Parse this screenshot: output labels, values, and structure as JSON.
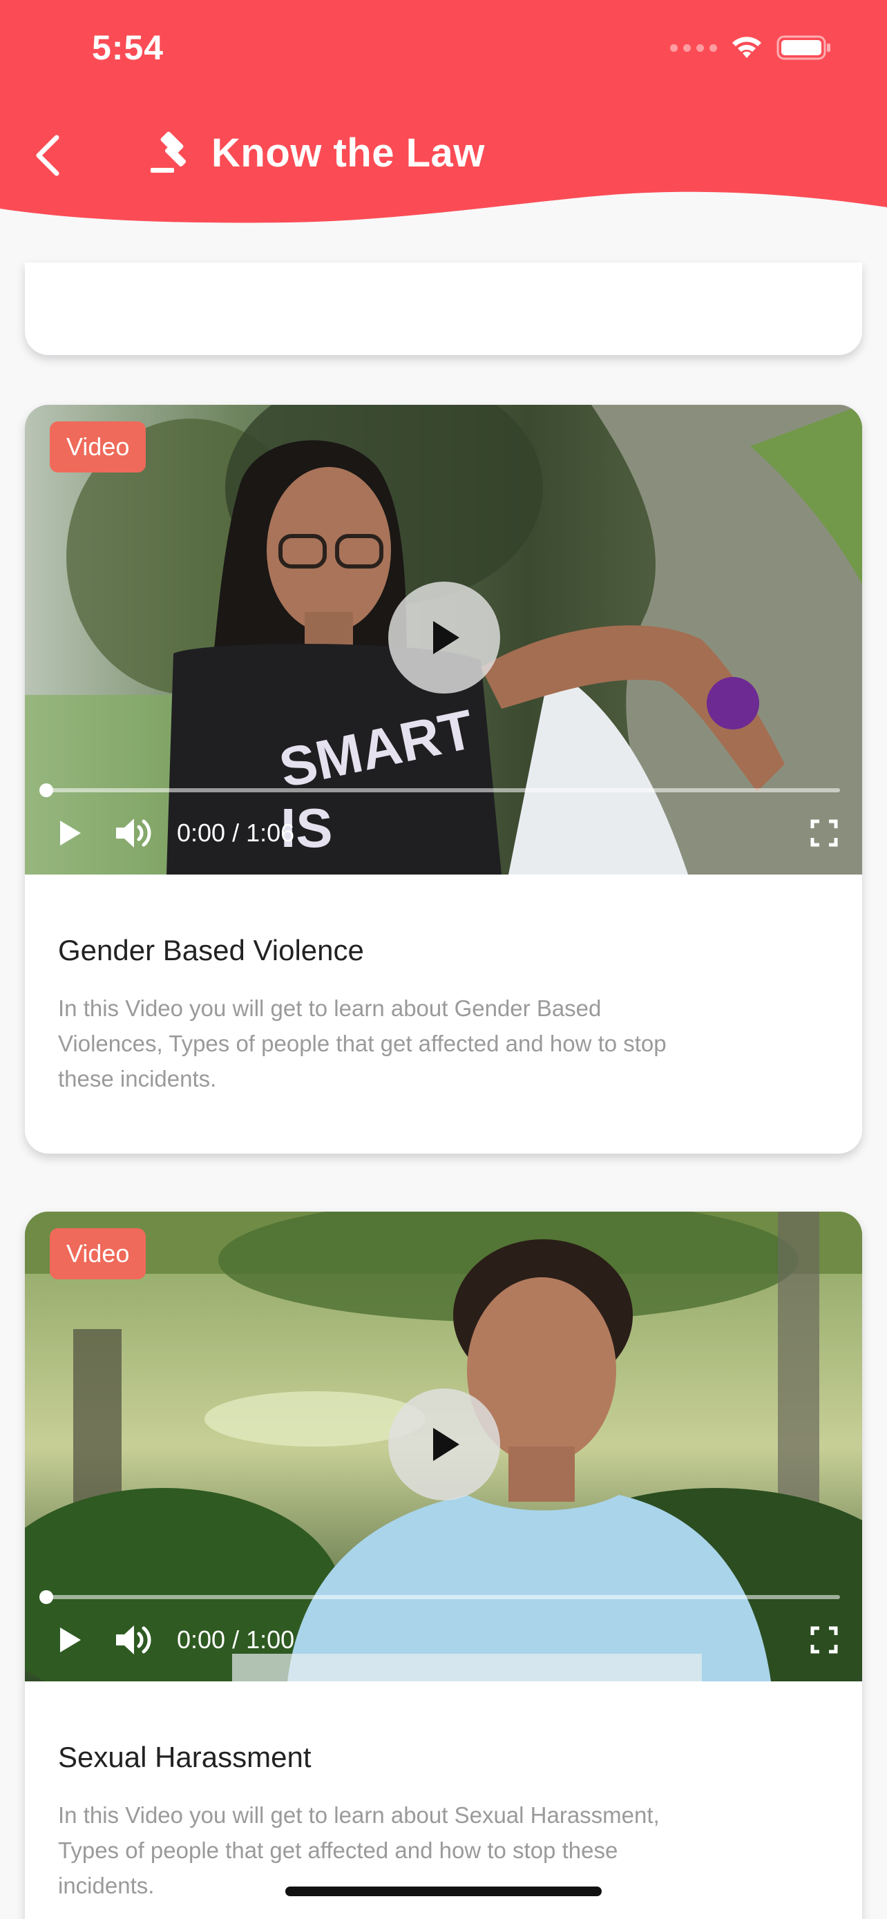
{
  "status_bar": {
    "time": "5:54"
  },
  "header": {
    "title": "Know the Law",
    "back_icon": "chevron-left-icon",
    "title_icon": "gavel-icon",
    "background_color": "#fb4c55"
  },
  "cards": [
    {
      "badge": "Video",
      "time_display": "0:00 / 1:06",
      "progress": 0,
      "title": "Gender Based Violence",
      "description": "In this Video you will get to learn about Gender Based Violences, Types of people that get affected and how to stop these incidents."
    },
    {
      "badge": "Video",
      "time_display": "0:00 / 1:00",
      "progress": 0,
      "title": "Sexual Harassment",
      "description": "In this Video you will get to learn about Sexual Harassment, Types of people that get affected and how to stop these incidents."
    }
  ],
  "icons": {
    "play": "play-icon",
    "volume": "volume-icon",
    "fullscreen": "fullscreen-icon"
  },
  "colors": {
    "badge": "#ef6a5a",
    "title_text": "#222222",
    "description_text": "#9a9a9a"
  }
}
